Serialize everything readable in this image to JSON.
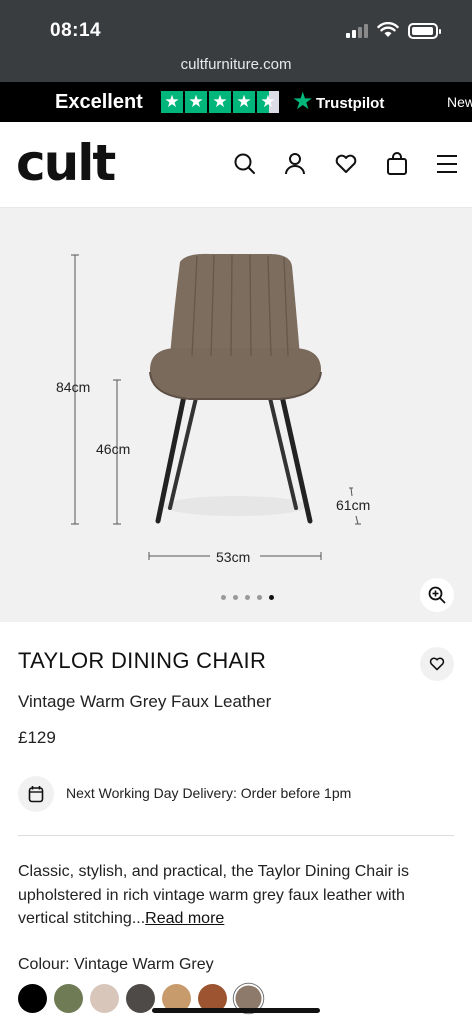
{
  "status": {
    "time": "08:14",
    "url": "cultfurniture.com"
  },
  "trustpilot": {
    "rating_text": "Excellent",
    "brand": "Trustpilot",
    "ticker": "New"
  },
  "header": {
    "logo": "cult"
  },
  "hero": {
    "dimensions": {
      "height": "84cm",
      "seat_height": "46cm",
      "depth": "61cm",
      "width": "53cm"
    },
    "gallery": {
      "total": 5,
      "active_index": 4
    }
  },
  "product": {
    "name": "TAYLOR DINING CHAIR",
    "variant": "Vintage Warm Grey Faux Leather",
    "price": "£129",
    "delivery": "Next Working Day Delivery: Order before 1pm",
    "description": "Classic, stylish, and practical, the Taylor Dining Chair is upholstered in rich vintage warm grey faux leather with vertical stitching...",
    "read_more": "Read more",
    "colour_label": "Colour: Vintage Warm Grey"
  },
  "swatches": [
    "#000000",
    "#6e7b55",
    "#d8c6bb",
    "#4e4a47",
    "#c89b6c",
    "#9d5430",
    "#8e7a6a"
  ],
  "colors": {
    "trustpilot_green": "#00b67a",
    "status_bg": "#3a3d40",
    "hero_bg": "#f1f1f1"
  },
  "icons": [
    "search-icon",
    "account-icon",
    "heart-icon",
    "bag-icon",
    "menu-icon",
    "zoom-icon",
    "calendar-icon"
  ]
}
